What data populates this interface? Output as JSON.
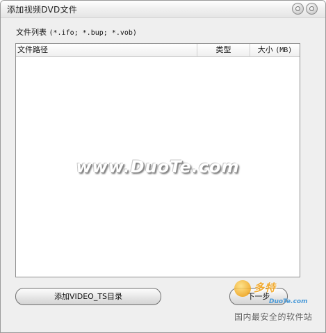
{
  "window": {
    "title": "添加视频DVD文件"
  },
  "title_buttons": {
    "minimize_icon": "circle-button-icon",
    "close_icon": "circle-button-icon"
  },
  "file_list": {
    "label": "文件列表",
    "hint": "(*.ifo; *.bup; *.vob)",
    "columns": {
      "path": "文件路径",
      "type": "类型",
      "size": "大小",
      "size_unit": "(MB)"
    },
    "rows": []
  },
  "watermark": {
    "text": "www.DuoTe.com"
  },
  "buttons": {
    "add_video_ts": "添加VIDEO_TS目录",
    "next": "下一步"
  },
  "brand_logo": {
    "name": "多特",
    "sub": "DuoTe.com",
    "tagline": "国内最安全的软件站"
  },
  "colors": {
    "window_bg": "#efefef",
    "list_bg": "#ffffff",
    "logo_accent": "#f2a41d"
  }
}
